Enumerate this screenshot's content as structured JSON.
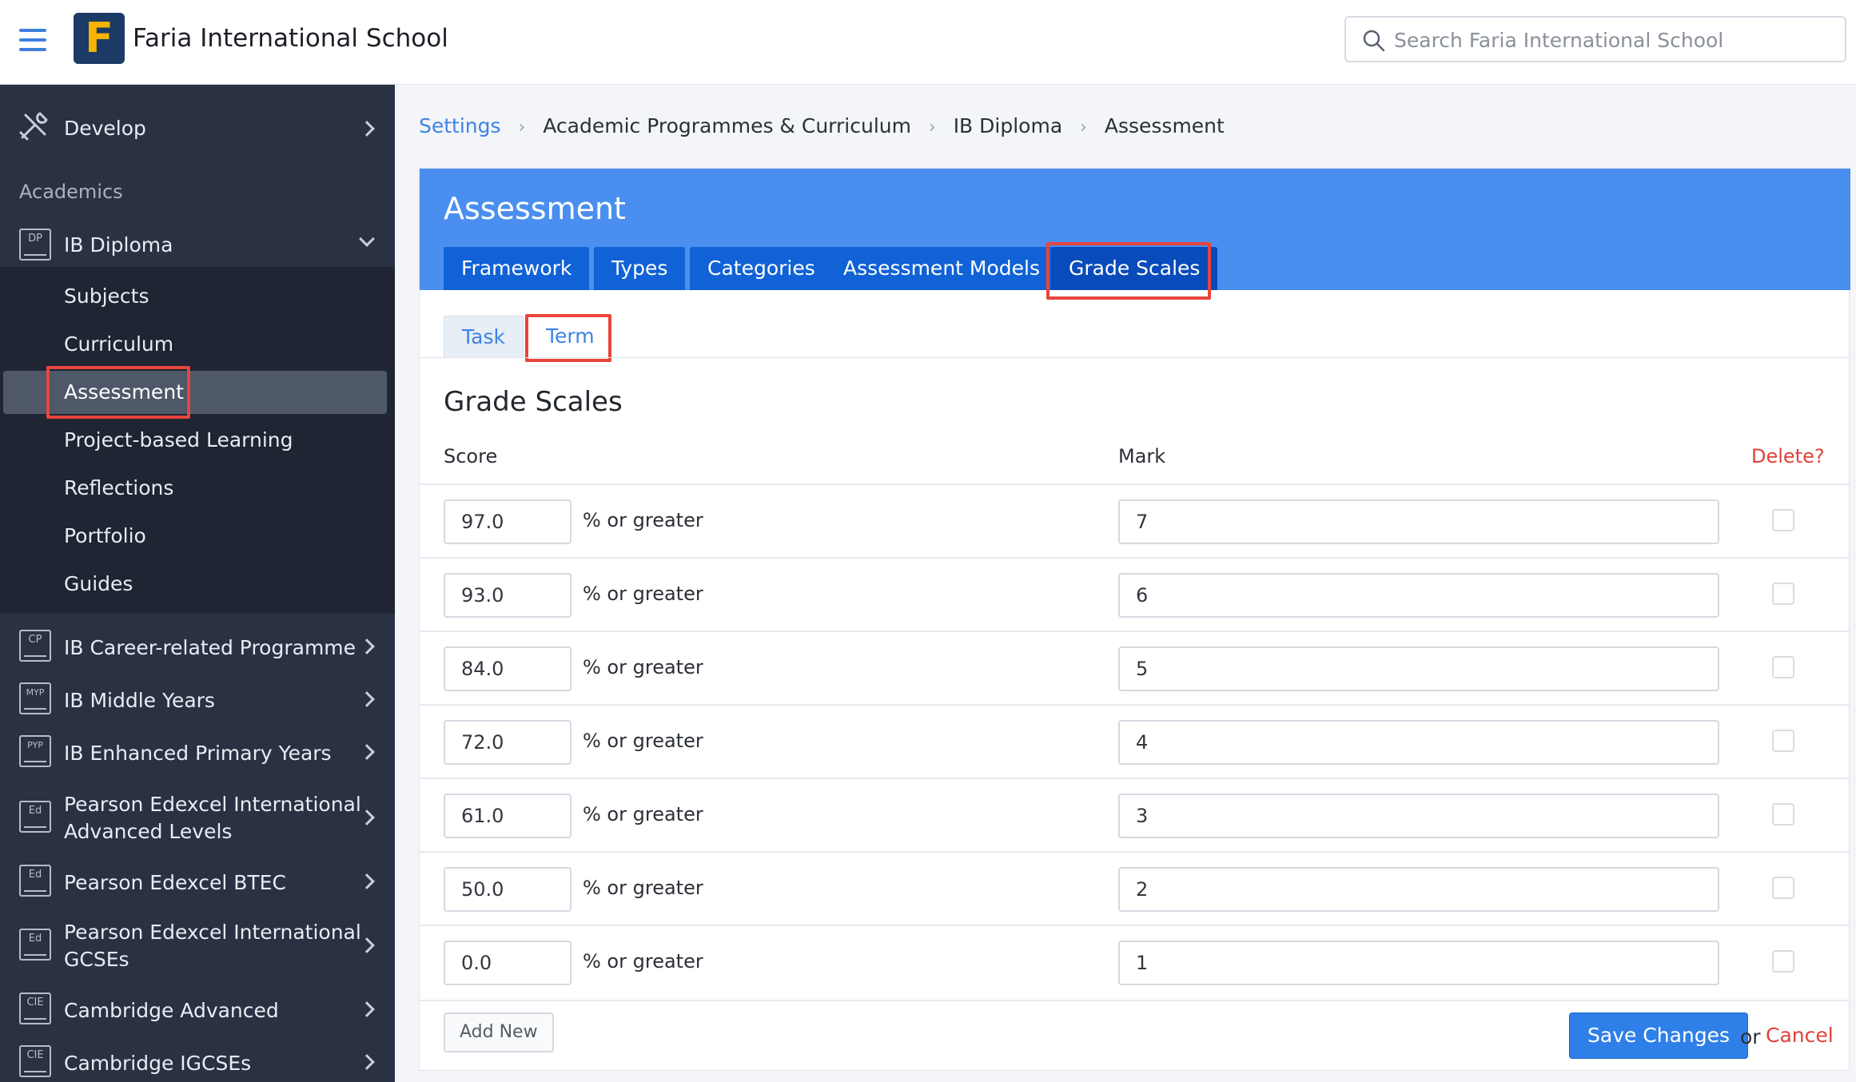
{
  "header": {
    "school_name": "Faria International School",
    "logo_letter": "F",
    "search_placeholder": "Search Faria International School"
  },
  "sidebar": {
    "develop_label": "Develop",
    "academics_heading": "Academics",
    "ib_diploma": {
      "icon_text": "DP",
      "label": "IB Diploma"
    },
    "ib_diploma_items": [
      "Subjects",
      "Curriculum",
      "Assessment",
      "Project-based Learning",
      "Reflections",
      "Portfolio",
      "Guides"
    ],
    "programmes": [
      {
        "icon_text": "CP",
        "label": "IB Career-related Programme"
      },
      {
        "icon_text": "MYP",
        "label": "IB Middle Years"
      },
      {
        "icon_text": "PYP",
        "label": "IB Enhanced Primary Years"
      },
      {
        "icon_text": "Ed",
        "label": "Pearson Edexcel International",
        "label2": "Advanced Levels"
      },
      {
        "icon_text": "Ed",
        "label": "Pearson Edexcel BTEC"
      },
      {
        "icon_text": "Ed",
        "label": "Pearson Edexcel International",
        "label2": "GCSEs"
      },
      {
        "icon_text": "CIE",
        "label": "Cambridge Advanced"
      },
      {
        "icon_text": "CIE",
        "label": "Cambridge IGCSEs"
      }
    ]
  },
  "breadcrumb": [
    "Settings",
    "Academic Programmes & Curriculum",
    "IB Diploma",
    "Assessment"
  ],
  "card": {
    "title": "Assessment",
    "tabs": [
      "Framework",
      "Types",
      "Categories",
      "Assessment Models",
      "Grade Scales"
    ],
    "subtabs": [
      "Task",
      "Term"
    ],
    "section_title": "Grade Scales",
    "col_score": "Score",
    "col_mark": "Mark",
    "col_delete": "Delete?",
    "or_greater": "% or greater",
    "rows": [
      {
        "score": "97.0",
        "mark": "7"
      },
      {
        "score": "93.0",
        "mark": "6"
      },
      {
        "score": "84.0",
        "mark": "5"
      },
      {
        "score": "72.0",
        "mark": "4"
      },
      {
        "score": "61.0",
        "mark": "3"
      },
      {
        "score": "50.0",
        "mark": "2"
      },
      {
        "score": "0.0",
        "mark": "1"
      }
    ],
    "add_new": "Add New",
    "save_changes": "Save Changes",
    "or_text": "or",
    "cancel": "Cancel"
  },
  "colors": {
    "accent": "#4a8ff0",
    "tab_blue": "#1062d6",
    "sidebar_bg": "#2a3142",
    "highlight_red": "#e8453c",
    "delete_red": "#e0413a"
  }
}
